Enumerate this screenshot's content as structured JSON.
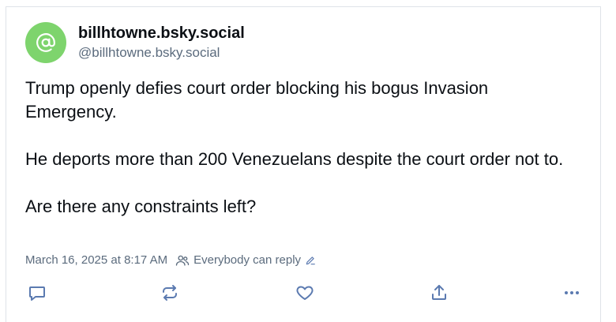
{
  "post": {
    "author": {
      "display_name": "billhtowne.bsky.social",
      "handle": "@billhtowne.bsky.social",
      "avatar_icon": "at-sign-icon",
      "avatar_color": "#7ed46d"
    },
    "paragraphs": [
      "Trump openly defies court order blocking his bogus Invasion Emergency.",
      "He deports more than 200 Venezuelans despite the court order not to.",
      "Are there any constraints left?"
    ],
    "timestamp": "March 16, 2025 at 8:17 AM",
    "reply_setting": "Everybody can reply"
  },
  "actions": [
    "reply-icon",
    "repost-icon",
    "like-icon",
    "share-icon",
    "more-icon"
  ],
  "colors": {
    "text": "#0b0f14",
    "muted": "#5b6b7d",
    "icon": "#5b7ab0",
    "border": "#dfe3e8"
  }
}
